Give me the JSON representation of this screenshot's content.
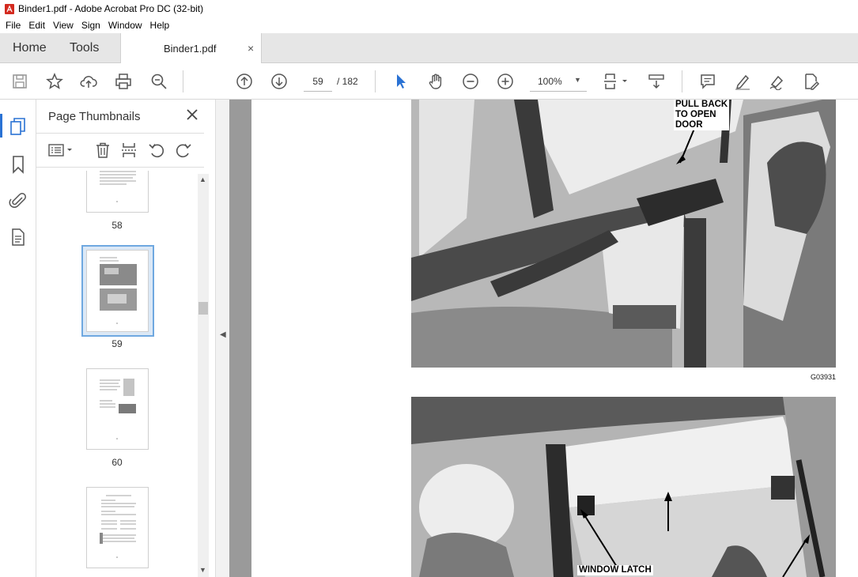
{
  "window": {
    "title": "Binder1.pdf - Adobe Acrobat Pro DC (32-bit)"
  },
  "menu": [
    "File",
    "Edit",
    "View",
    "Sign",
    "Window",
    "Help"
  ],
  "tabs": {
    "home": "Home",
    "tools": "Tools",
    "document": "Binder1.pdf",
    "close": "×"
  },
  "toolbar": {
    "page_current": "59",
    "page_total": "/ 182",
    "zoom": "100%"
  },
  "panel": {
    "title": "Page Thumbnails",
    "thumbnails": [
      {
        "label": "58"
      },
      {
        "label": "59",
        "selected": true
      },
      {
        "label": "60"
      },
      {
        "label": ""
      }
    ]
  },
  "document": {
    "callout_top": [
      "PULL BACK",
      "TO OPEN",
      "DOOR"
    ],
    "figure_code": "G03931",
    "callout_bottom": "WINDOW LATCH"
  },
  "colors": {
    "accent": "#2a72d4",
    "selection": "#6fa8e0"
  }
}
